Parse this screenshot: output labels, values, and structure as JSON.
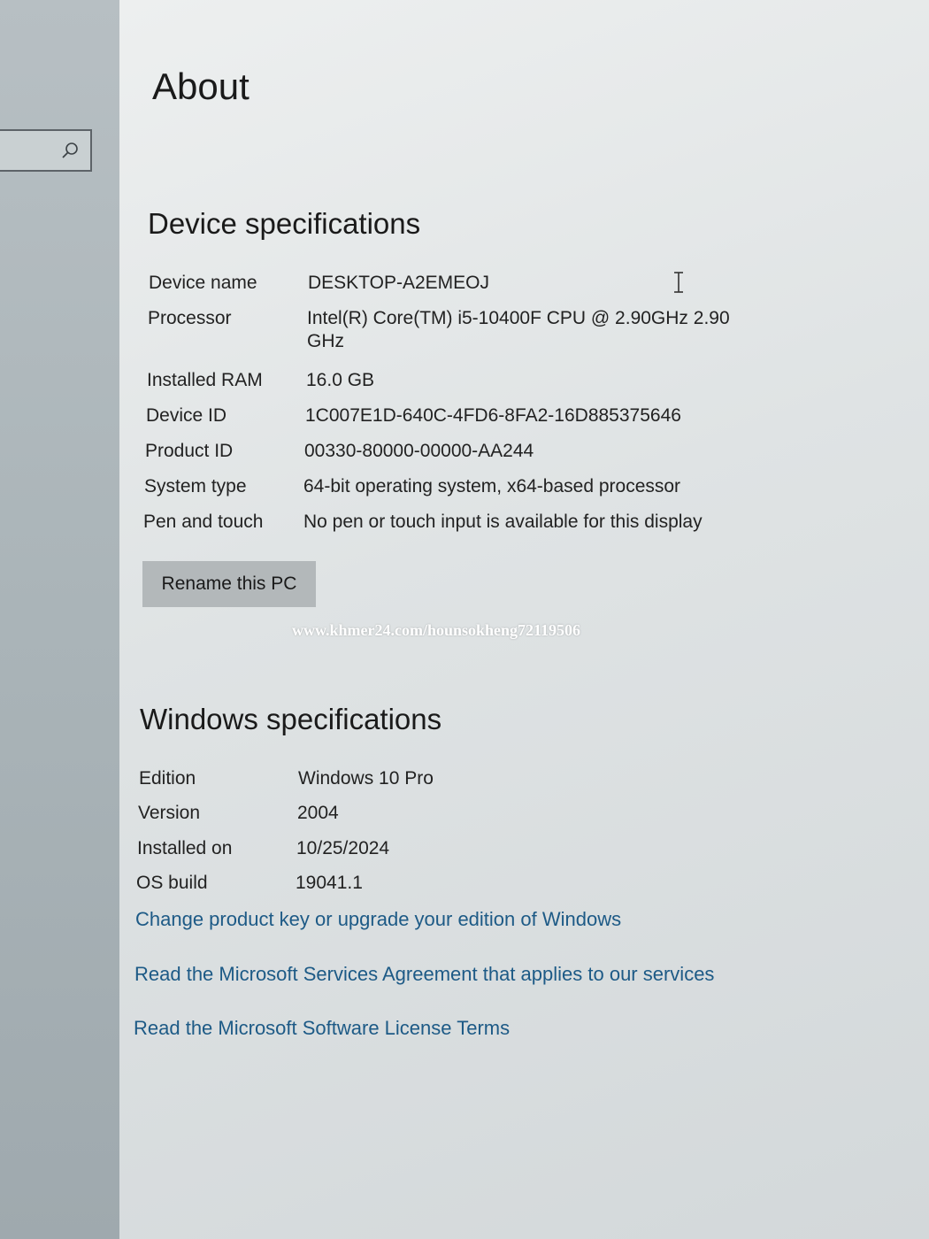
{
  "page": {
    "title": "About"
  },
  "sidebar": {
    "search_icon": "search-icon"
  },
  "device_specifications": {
    "heading": "Device specifications",
    "rows": [
      {
        "label": "Device name",
        "value": "DESKTOP-A2EMEOJ"
      },
      {
        "label": "Processor",
        "value": "Intel(R) Core(TM) i5-10400F CPU @ 2.90GHz   2.90 GHz"
      },
      {
        "label": "Installed RAM",
        "value": "16.0 GB"
      },
      {
        "label": "Device ID",
        "value": "1C007E1D-640C-4FD6-8FA2-16D885375646"
      },
      {
        "label": "Product ID",
        "value": "00330-80000-00000-AA244"
      },
      {
        "label": "System type",
        "value": "64-bit operating system, x64-based processor"
      },
      {
        "label": "Pen and touch",
        "value": "No pen or touch input is available for this display"
      }
    ],
    "rename_button": "Rename this PC"
  },
  "watermark": "www.khmer24.com/hounsokheng72119506",
  "windows_specifications": {
    "heading": "Windows specifications",
    "rows": [
      {
        "label": "Edition",
        "value": "Windows 10 Pro"
      },
      {
        "label": "Version",
        "value": "2004"
      },
      {
        "label": "Installed on",
        "value": "10/25/2024"
      },
      {
        "label": "OS build",
        "value": "19041.1"
      }
    ],
    "links": [
      "Change product key or upgrade your edition of Windows",
      "Read the Microsoft Services Agreement that applies to our services",
      "Read the Microsoft Software License Terms"
    ]
  },
  "colors": {
    "link": "#1d5a86",
    "button": "#b3b8ba"
  }
}
